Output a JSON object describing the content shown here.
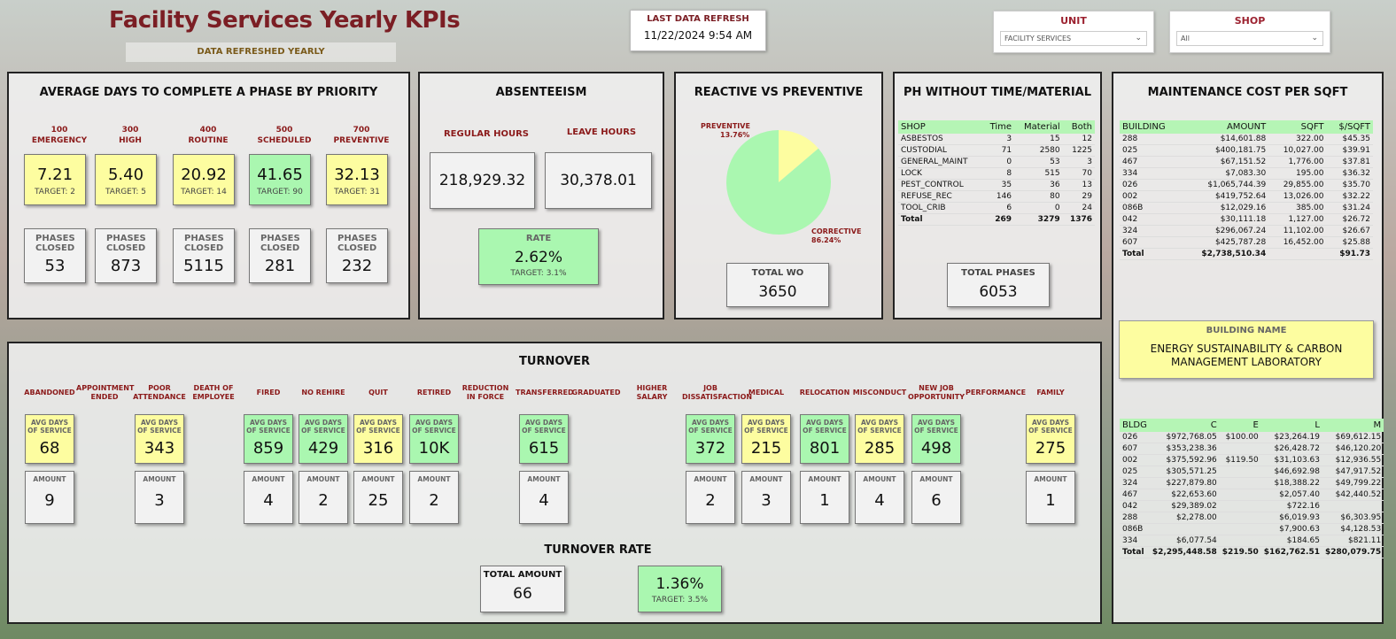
{
  "header": {
    "title": "Facility Services Yearly KPIs",
    "subtitle": "DATA REFRESHED YEARLY",
    "refresh_label": "LAST DATA REFRESH",
    "refresh_value": "11/22/2024 9:54 AM"
  },
  "filters": {
    "unit": {
      "label": "UNIT",
      "value": "FACILITY SERVICES"
    },
    "shop": {
      "label": "SHOP",
      "value": "All"
    }
  },
  "avg_days": {
    "title": "AVERAGE DAYS TO COMPLETE A PHASE BY PRIORITY",
    "phases_label": "PHASES CLOSED",
    "items": [
      {
        "code": "100",
        "name": "EMERGENCY",
        "value": "7.21",
        "target": "TARGET: 2",
        "closed": "53"
      },
      {
        "code": "300",
        "name": "HIGH",
        "value": "5.40",
        "target": "TARGET: 5",
        "closed": "873"
      },
      {
        "code": "400",
        "name": "ROUTINE",
        "value": "20.92",
        "target": "TARGET: 14",
        "closed": "5115"
      },
      {
        "code": "500",
        "name": "SCHEDULED",
        "value": "41.65",
        "target": "TARGET: 90",
        "closed": "281"
      },
      {
        "code": "700",
        "name": "PREVENTIVE",
        "value": "32.13",
        "target": "TARGET: 31",
        "closed": "232"
      }
    ]
  },
  "absenteeism": {
    "title": "ABSENTEEISM",
    "regular_label": "REGULAR HOURS",
    "regular_value": "218,929.32",
    "leave_label": "LEAVE HOURS",
    "leave_value": "30,378.01",
    "rate_label": "RATE",
    "rate_value": "2.62%",
    "rate_target": "TARGET: 3.1%"
  },
  "reactive": {
    "title": "REACTIVE VS PREVENTIVE",
    "preventive_label": "PREVENTIVE",
    "preventive_pct": "13.76%",
    "corrective_label": "CORRECTIVE",
    "corrective_pct": "86.24%",
    "total_label": "TOTAL WO",
    "total_value": "3650",
    "colors": {
      "preventive": "#fdfda0",
      "corrective": "#aaf7b0"
    }
  },
  "chart_data": {
    "type": "pie",
    "categories": [
      "PREVENTIVE",
      "CORRECTIVE"
    ],
    "values": [
      13.76,
      86.24
    ]
  },
  "ph_without": {
    "title": "PH WITHOUT TIME/MATERIAL",
    "columns": [
      "SHOP",
      "Time",
      "Material",
      "Both"
    ],
    "rows": [
      [
        "ASBESTOS",
        "3",
        "15",
        "12"
      ],
      [
        "CUSTODIAL",
        "71",
        "2580",
        "1225"
      ],
      [
        "GENERAL_MAINT",
        "0",
        "53",
        "3"
      ],
      [
        "LOCK",
        "8",
        "515",
        "70"
      ],
      [
        "PEST_CONTROL",
        "35",
        "36",
        "13"
      ],
      [
        "REFUSE_REC",
        "146",
        "80",
        "29"
      ],
      [
        "TOOL_CRIB",
        "6",
        "0",
        "24"
      ]
    ],
    "total": [
      "Total",
      "269",
      "3279",
      "1376"
    ],
    "total_phases_label": "TOTAL PHASES",
    "total_phases_value": "6053"
  },
  "maint_cost": {
    "title": "MAINTENANCE COST PER SQFT",
    "columns": [
      "BUILDING",
      "AMOUNT",
      "SQFT",
      "$/SQFT"
    ],
    "rows": [
      [
        "288",
        "$14,601.88",
        "322.00",
        "$45.35"
      ],
      [
        "025",
        "$400,181.75",
        "10,027.00",
        "$39.91"
      ],
      [
        "467",
        "$67,151.52",
        "1,776.00",
        "$37.81"
      ],
      [
        "334",
        "$7,083.30",
        "195.00",
        "$36.32"
      ],
      [
        "026",
        "$1,065,744.39",
        "29,855.00",
        "$35.70"
      ],
      [
        "002",
        "$419,752.64",
        "13,026.00",
        "$32.22"
      ],
      [
        "086B",
        "$12,029.16",
        "385.00",
        "$31.24"
      ],
      [
        "042",
        "$30,111.18",
        "1,127.00",
        "$26.72"
      ],
      [
        "324",
        "$296,067.24",
        "11,102.00",
        "$26.67"
      ],
      [
        "607",
        "$425,787.28",
        "16,452.00",
        "$25.88"
      ]
    ],
    "total": [
      "Total",
      "$2,738,510.34",
      "",
      "$91.73"
    ]
  },
  "building": {
    "label": "BUILDING NAME",
    "value": "ENERGY SUSTAINABILITY & CARBON MANAGEMENT LABORATORY"
  },
  "bldg_table": {
    "columns": [
      "BLDG",
      "C",
      "E",
      "L",
      "M"
    ],
    "rows": [
      [
        "026",
        "$972,768.05",
        "$100.00",
        "$23,264.19",
        "$69,612.15"
      ],
      [
        "607",
        "$353,238.36",
        "",
        "$26,428.72",
        "$46,120.20"
      ],
      [
        "002",
        "$375,592.96",
        "$119.50",
        "$31,103.63",
        "$12,936.55"
      ],
      [
        "025",
        "$305,571.25",
        "",
        "$46,692.98",
        "$47,917.52"
      ],
      [
        "324",
        "$227,879.80",
        "",
        "$18,388.22",
        "$49,799.22"
      ],
      [
        "467",
        "$22,653.60",
        "",
        "$2,057.40",
        "$42,440.52"
      ],
      [
        "042",
        "$29,389.02",
        "",
        "$722.16",
        ""
      ],
      [
        "288",
        "$2,278.00",
        "",
        "$6,019.93",
        "$6,303.95"
      ],
      [
        "086B",
        "",
        "",
        "$7,900.63",
        "$4,128.53"
      ],
      [
        "334",
        "$6,077.54",
        "",
        "$184.65",
        "$821.11"
      ]
    ],
    "total": [
      "Total",
      "$2,295,448.58",
      "$219.50",
      "$162,762.51",
      "$280,079.75"
    ]
  },
  "turnover": {
    "title": "TURNOVER",
    "avg_label": "AVG DAYS OF SERVICE",
    "amount_label": "AMOUNT",
    "categories": [
      {
        "name": "ABANDONED",
        "avg": "68",
        "amount": "9",
        "color": "yellow"
      },
      {
        "name": "APPOINTMENT ENDED"
      },
      {
        "name": "POOR ATTENDANCE",
        "avg": "343",
        "amount": "3",
        "color": "yellow"
      },
      {
        "name": "DEATH OF EMPLOYEE"
      },
      {
        "name": "FIRED",
        "avg": "859",
        "amount": "4",
        "color": "green"
      },
      {
        "name": "NO REHIRE",
        "avg": "429",
        "amount": "2",
        "color": "green"
      },
      {
        "name": "QUIT",
        "avg": "316",
        "amount": "25",
        "color": "yellow"
      },
      {
        "name": "RETIRED",
        "avg": "10K",
        "amount": "2",
        "color": "green"
      },
      {
        "name": "REDUCTION IN FORCE"
      },
      {
        "name": "TRANSFERRED",
        "avg": "615",
        "amount": "4",
        "color": "green"
      },
      {
        "name": "GRADUATED"
      },
      {
        "name": "HIGHER SALARY"
      },
      {
        "name": "JOB DISSATISFACTION",
        "avg": "372",
        "amount": "2",
        "color": "green"
      },
      {
        "name": "MEDICAL",
        "avg": "215",
        "amount": "3",
        "color": "yellow"
      },
      {
        "name": "RELOCATION",
        "avg": "801",
        "amount": "1",
        "color": "green"
      },
      {
        "name": "MISCONDUCT",
        "avg": "285",
        "amount": "4",
        "color": "yellow"
      },
      {
        "name": "NEW JOB OPPORTUNITY",
        "avg": "498",
        "amount": "6",
        "color": "green"
      },
      {
        "name": "PERFORMANCE"
      },
      {
        "name": "FAMILY",
        "avg": "275",
        "amount": "1",
        "color": "yellow"
      }
    ],
    "rate_title": "TURNOVER RATE",
    "total_amount_label": "TOTAL AMOUNT",
    "total_amount_value": "66",
    "rate_value": "1.36%",
    "rate_target": "TARGET: 3.5%"
  }
}
